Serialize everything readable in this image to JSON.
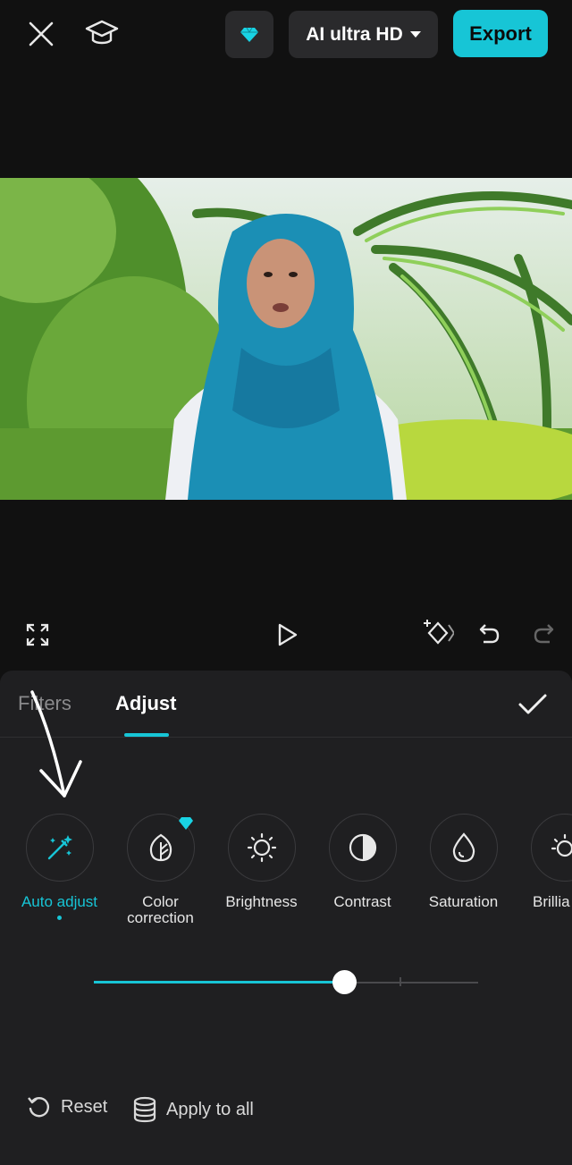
{
  "header": {
    "quality_label": "AI ultra HD",
    "export_label": "Export"
  },
  "tabs": [
    {
      "label": "Filters",
      "active": false
    },
    {
      "label": "Adjust",
      "active": true
    }
  ],
  "tools": [
    {
      "label": "Auto adjust",
      "icon": "magic-wand-icon",
      "active": true
    },
    {
      "label": "Color\ncorrection",
      "icon": "leaf-icon",
      "pro": true
    },
    {
      "label": "Brightness",
      "icon": "sun-icon"
    },
    {
      "label": "Contrast",
      "icon": "contrast-icon"
    },
    {
      "label": "Saturation",
      "icon": "droplet-icon"
    },
    {
      "label": "Brillia",
      "icon": "brilliance-icon"
    }
  ],
  "slider": {
    "value_fraction": 0.65
  },
  "actions": {
    "reset_label": "Reset",
    "apply_label": "Apply to all"
  },
  "colors": {
    "accent": "#17c5d6",
    "panel": "#1f1f21",
    "background": "#111111"
  }
}
